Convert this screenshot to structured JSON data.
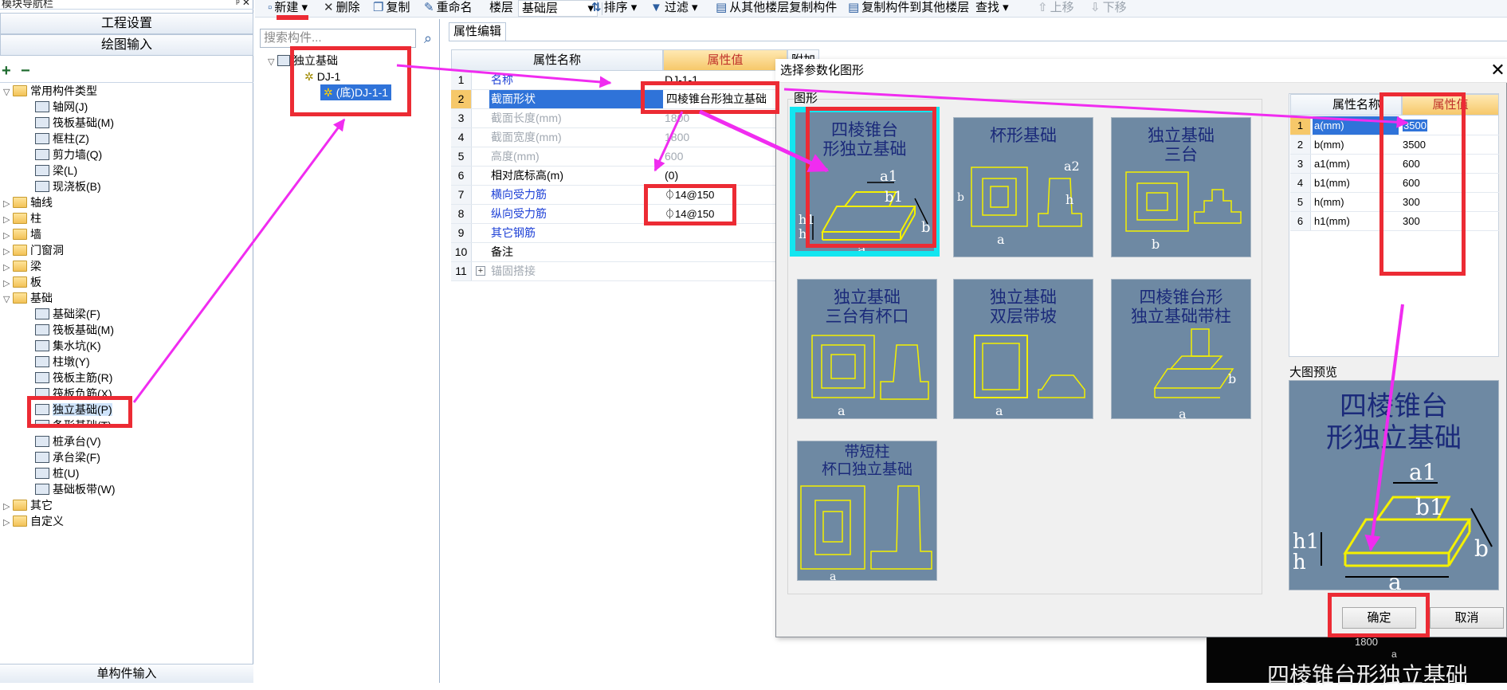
{
  "nav": {
    "title": "模块导航栏",
    "title_controls": "ᵖ ✕",
    "project_settings": "工程设置",
    "drawing_input": "绘图输入",
    "add_label": "+",
    "remove_label": "−",
    "bottom": "单构件输入",
    "tree": {
      "common_types": "常用构件类型",
      "common_items": [
        "轴网(J)",
        "筏板基础(M)",
        "框柱(Z)",
        "剪力墙(Q)",
        "梁(L)",
        "现浇板(B)"
      ],
      "categories": [
        "轴线",
        "柱",
        "墙",
        "门窗洞",
        "梁",
        "板"
      ],
      "foundation": "基础",
      "foundation_items": [
        "基础梁(F)",
        "筏板基础(M)",
        "集水坑(K)",
        "柱墩(Y)",
        "筏板主筋(R)",
        "筏板负筋(X)",
        "独立基础(P)",
        "条形基础(T)",
        "桩承台(V)",
        "承台梁(F)",
        "桩(U)",
        "基础板带(W)"
      ],
      "other": "其它",
      "custom": "自定义"
    }
  },
  "toolbar": {
    "new": "新建",
    "delete": "删除",
    "copy": "复制",
    "rename": "重命名",
    "floor_label": "楼层",
    "floor_value": "基础层",
    "sort": "排序",
    "filter": "过滤",
    "copy_from_floors": "从其他楼层复制构件",
    "copy_to_floors": "复制构件到其他楼层",
    "find": "查找",
    "move_up": "上移",
    "move_down": "下移"
  },
  "components": {
    "search_placeholder": "搜索构件...",
    "root": "独立基础",
    "child": "DJ-1",
    "grandchild": "(底)DJ-1-1"
  },
  "property_editor": {
    "tab": "属性编辑",
    "col_name": "属性名称",
    "col_value": "属性值",
    "col_extra": "附加",
    "rows": [
      {
        "num": "1",
        "name": "名称",
        "value": "DJ-1-1"
      },
      {
        "num": "2",
        "name": "截面形状",
        "value": "四棱锥台形独立基础"
      },
      {
        "num": "3",
        "name": "截面长度(mm)",
        "value": "1800"
      },
      {
        "num": "4",
        "name": "截面宽度(mm)",
        "value": "1800"
      },
      {
        "num": "5",
        "name": "高度(mm)",
        "value": "600"
      },
      {
        "num": "6",
        "name": "相对底标高(m)",
        "value": "(0)"
      },
      {
        "num": "7",
        "name": "横向受力筋",
        "value": "⏀14@150"
      },
      {
        "num": "8",
        "name": "纵向受力筋",
        "value": "⏀14@150"
      },
      {
        "num": "9",
        "name": "其它钢筋",
        "value": ""
      },
      {
        "num": "10",
        "name": "备注",
        "value": ""
      },
      {
        "num": "11",
        "name": "锚固搭接",
        "value": ""
      }
    ]
  },
  "dialog": {
    "title": "选择参数化图形",
    "close": "✕",
    "shapes_label": "图形",
    "shapes": [
      {
        "title": "四棱锥台\n形独立基础"
      },
      {
        "title": "杯形基础"
      },
      {
        "title": "独立基础\n三台"
      },
      {
        "title": "独立基础\n三台有杯口"
      },
      {
        "title": "独立基础\n双层带坡"
      },
      {
        "title": "四棱锥台形\n独立基础带柱"
      },
      {
        "title": "带短柱\n杯口独立基础"
      }
    ],
    "param_col_name": "属性名称",
    "param_col_value": "属性值",
    "params": [
      {
        "num": "1",
        "name": "a(mm)",
        "value": "3500"
      },
      {
        "num": "2",
        "name": "b(mm)",
        "value": "3500"
      },
      {
        "num": "3",
        "name": "a1(mm)",
        "value": "600"
      },
      {
        "num": "4",
        "name": "b1(mm)",
        "value": "600"
      },
      {
        "num": "5",
        "name": "h(mm)",
        "value": "300"
      },
      {
        "num": "6",
        "name": "h1(mm)",
        "value": "300"
      }
    ],
    "preview_label": "大图预览",
    "preview_title": "四棱锥台\n形独立基础",
    "ok": "确定",
    "cancel": "取消"
  },
  "drawing": {
    "dim": "1800",
    "a": "a",
    "title": "四棱锥台形独立基础"
  },
  "colors": {
    "annotation_box": "#ec2b34",
    "annotation_arrow": "#f02cf0",
    "selection_blue": "#2f73d9",
    "thumbnail_bg": "#6e89a3",
    "thumbnail_selected": "#13e6f0"
  }
}
